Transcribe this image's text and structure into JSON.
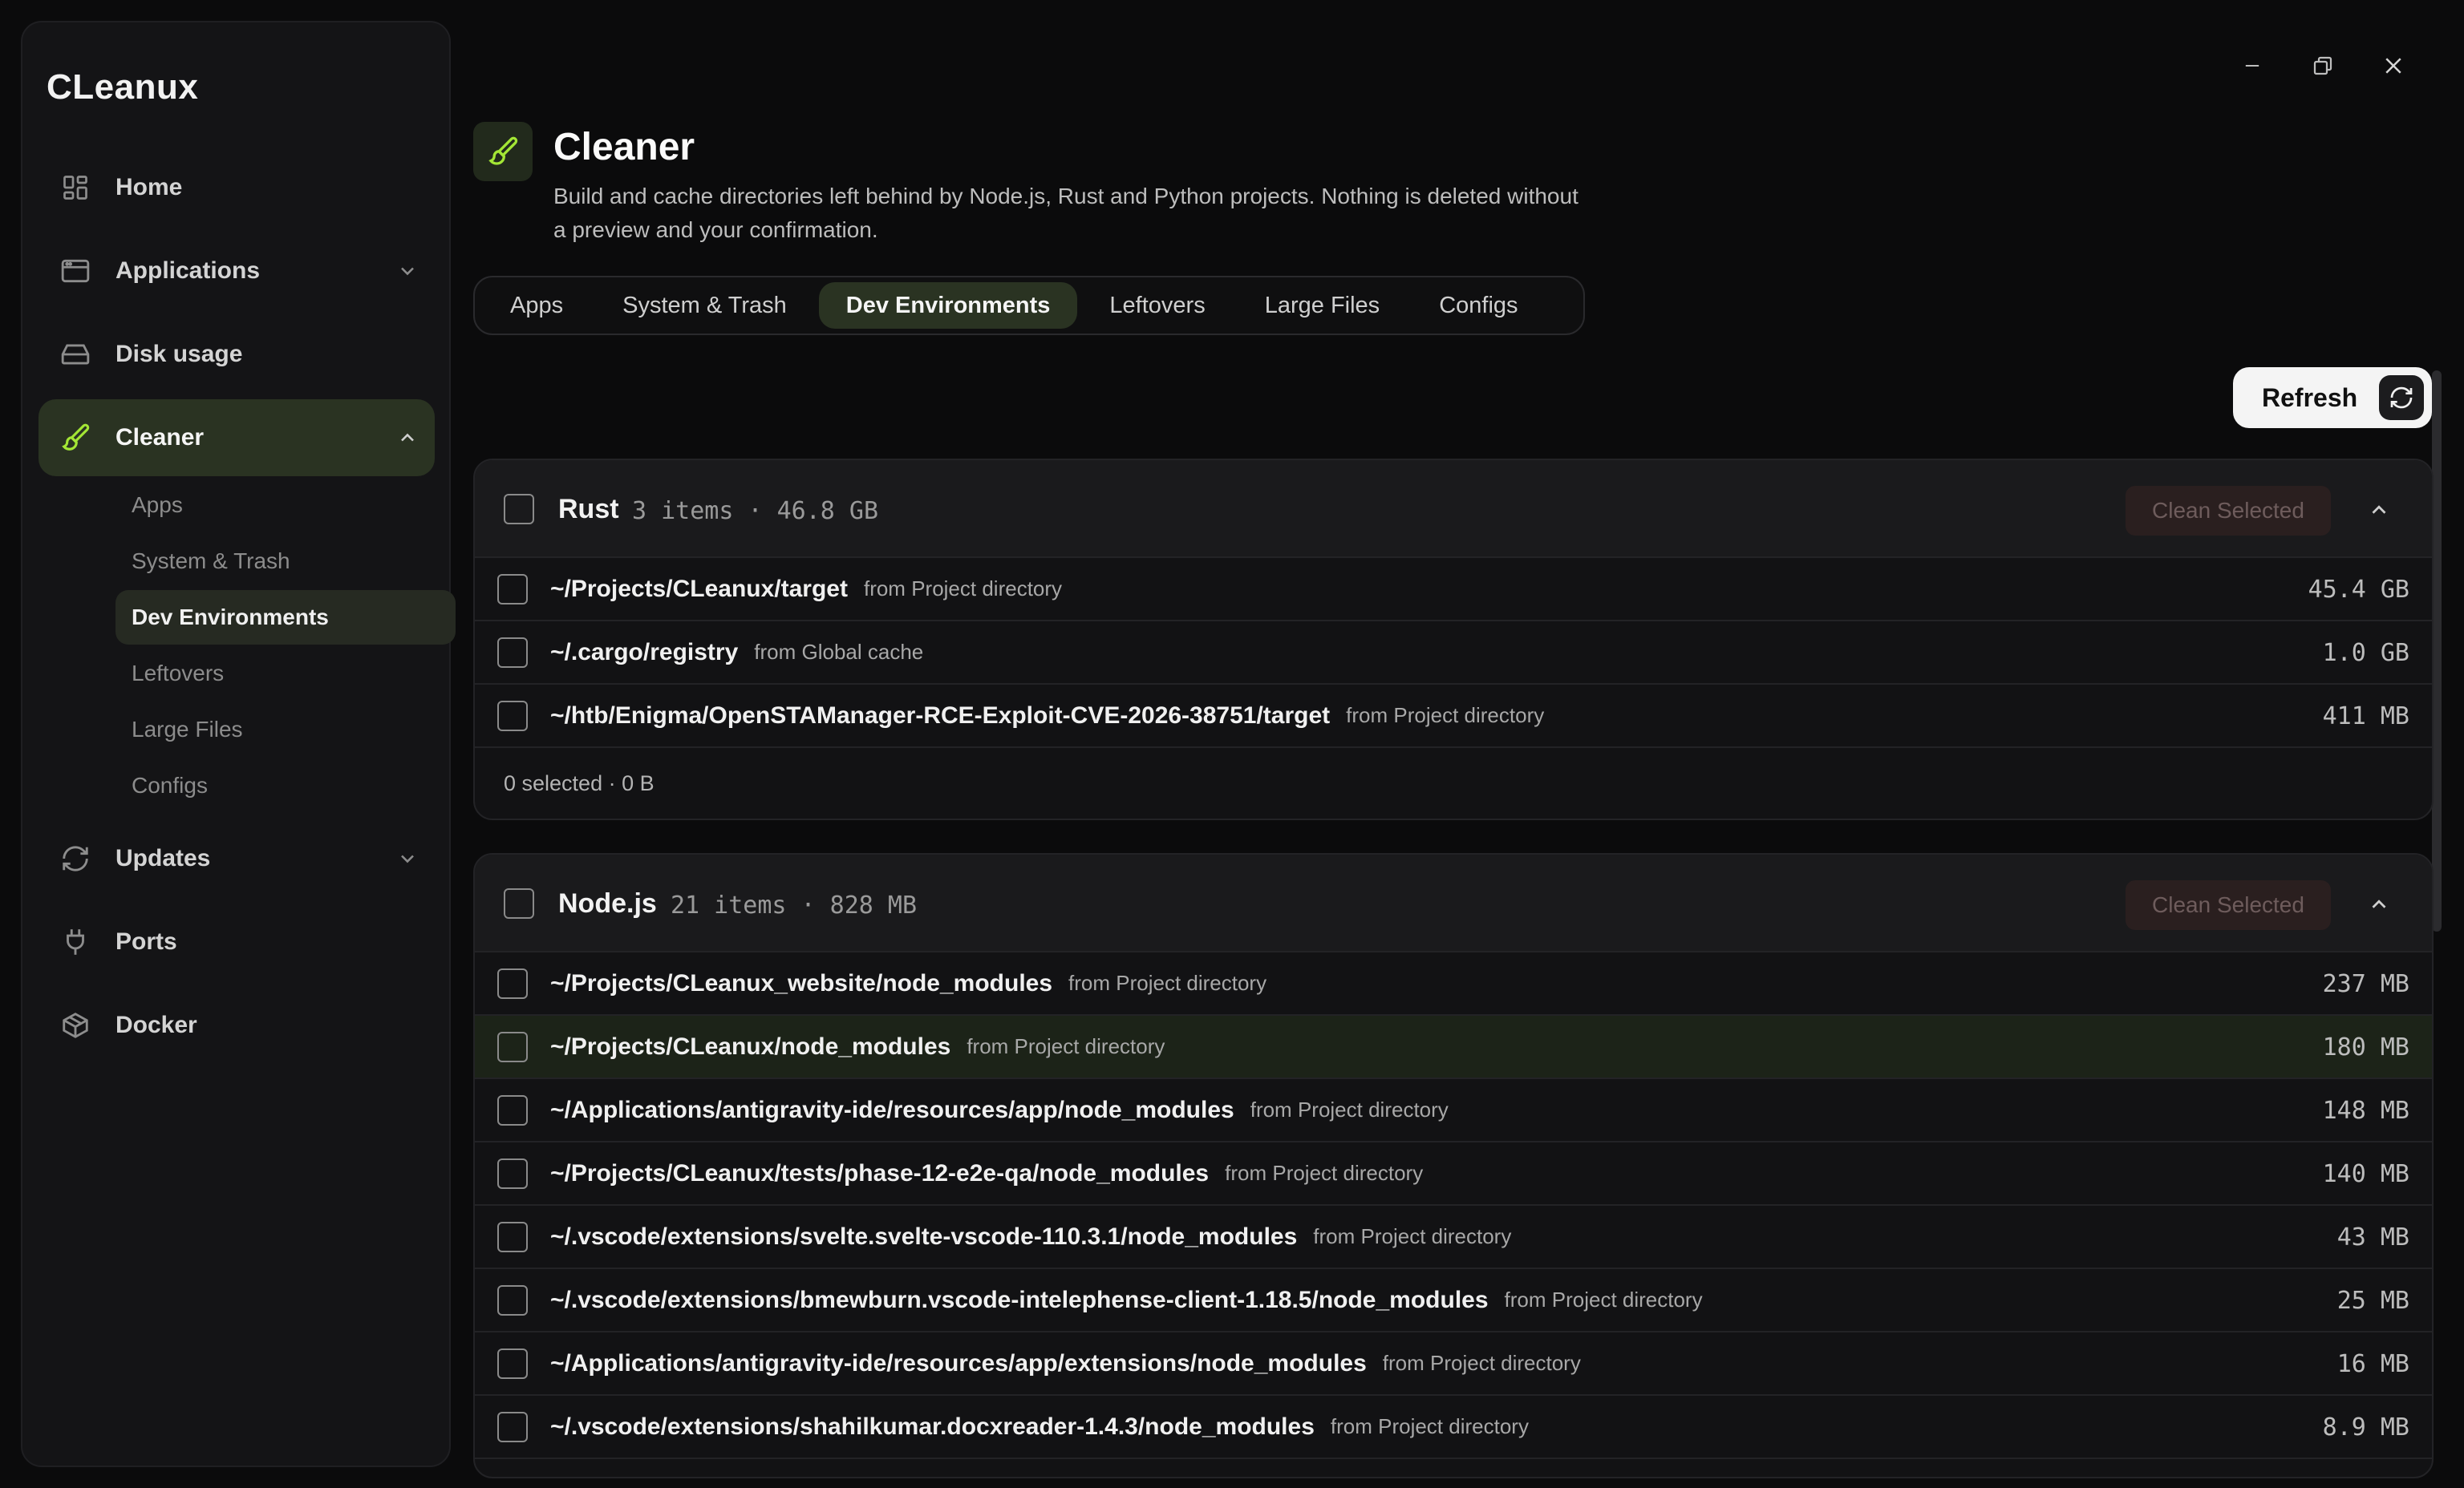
{
  "app": {
    "name": "CLeanux"
  },
  "sidebar": {
    "items": [
      {
        "label": "Home",
        "icon": "grid-icon"
      },
      {
        "label": "Applications",
        "icon": "window-icon"
      },
      {
        "label": "Disk usage",
        "icon": "hard-drive-icon"
      },
      {
        "label": "Cleaner",
        "icon": "brush-icon"
      },
      {
        "label": "Updates",
        "icon": "refresh-icon"
      },
      {
        "label": "Ports",
        "icon": "plug-icon"
      },
      {
        "label": "Docker",
        "icon": "box-icon"
      }
    ],
    "cleaner_sub": [
      {
        "label": "Apps"
      },
      {
        "label": "System & Trash"
      },
      {
        "label": "Dev Environments"
      },
      {
        "label": "Leftovers"
      },
      {
        "label": "Large Files"
      },
      {
        "label": "Configs"
      }
    ]
  },
  "header": {
    "title": "Cleaner",
    "description": "Build and cache directories left behind by Node.js, Rust and Python projects. Nothing is deleted without a preview and your confirmation."
  },
  "tabs": [
    {
      "label": "Apps"
    },
    {
      "label": "System & Trash"
    },
    {
      "label": "Dev Environments"
    },
    {
      "label": "Leftovers"
    },
    {
      "label": "Large Files"
    },
    {
      "label": "Configs"
    }
  ],
  "toolbar": {
    "refresh_label": "Refresh"
  },
  "groups": [
    {
      "name": "Rust",
      "meta": "3 items · 46.8 GB",
      "clean_label": "Clean Selected",
      "footer": "0 selected · 0 B",
      "rows": [
        {
          "path": "~/Projects/CLeanux/target",
          "source": "from Project directory",
          "size": "45.4 GB"
        },
        {
          "path": "~/.cargo/registry",
          "source": "from Global cache",
          "size": "1.0 GB"
        },
        {
          "path": "~/htb/Enigma/OpenSTAManager-RCE-Exploit-CVE-2026-38751/target",
          "source": "from Project directory",
          "size": "411 MB"
        }
      ]
    },
    {
      "name": "Node.js",
      "meta": "21 items · 828 MB",
      "clean_label": "Clean Selected",
      "rows": [
        {
          "path": "~/Projects/CLeanux_website/node_modules",
          "source": "from Project directory",
          "size": "237 MB"
        },
        {
          "path": "~/Projects/CLeanux/node_modules",
          "source": "from Project directory",
          "size": "180 MB"
        },
        {
          "path": "~/Applications/antigravity-ide/resources/app/node_modules",
          "source": "from Project directory",
          "size": "148 MB"
        },
        {
          "path": "~/Projects/CLeanux/tests/phase-12-e2e-qa/node_modules",
          "source": "from Project directory",
          "size": "140 MB"
        },
        {
          "path": "~/.vscode/extensions/svelte.svelte-vscode-110.3.1/node_modules",
          "source": "from Project directory",
          "size": "43 MB"
        },
        {
          "path": "~/.vscode/extensions/bmewburn.vscode-intelephense-client-1.18.5/node_modules",
          "source": "from Project directory",
          "size": "25 MB"
        },
        {
          "path": "~/Applications/antigravity-ide/resources/app/extensions/node_modules",
          "source": "from Project directory",
          "size": "16 MB"
        },
        {
          "path": "~/.vscode/extensions/shahilkumar.docxreader-1.4.3/node_modules",
          "source": "from Project directory",
          "size": "8.9 MB"
        }
      ]
    }
  ],
  "colors": {
    "accent": "#a3e635",
    "active_bg": "#2a3322",
    "clean_disabled_bg": "#2a1f1f"
  }
}
